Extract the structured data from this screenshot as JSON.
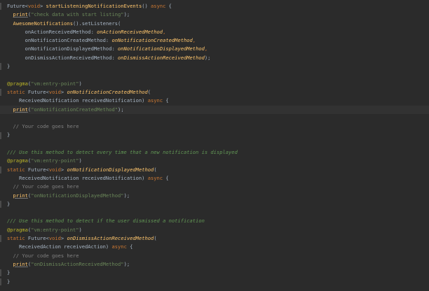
{
  "lines": [
    [
      {
        "t": "Future<",
        "c": "plain"
      },
      {
        "t": "void",
        "c": "kw"
      },
      {
        "t": "> ",
        "c": "plain"
      },
      {
        "t": "startListeningNotificationEvents",
        "c": "fn"
      },
      {
        "t": "() ",
        "c": "plain"
      },
      {
        "t": "async",
        "c": "kw"
      },
      {
        "t": " {",
        "c": "plain"
      }
    ],
    [
      {
        "t": "  ",
        "c": "plain"
      },
      {
        "t": "print",
        "c": "call-u"
      },
      {
        "t": "(",
        "c": "plain"
      },
      {
        "t": "\"check data with start listing\"",
        "c": "str"
      },
      {
        "t": ");",
        "c": "plain"
      }
    ],
    [
      {
        "t": "  ",
        "c": "plain"
      },
      {
        "t": "AwesomeNotifications",
        "c": "call"
      },
      {
        "t": "().setListeners(",
        "c": "plain"
      }
    ],
    [
      {
        "t": "      onActionReceivedMethod: ",
        "c": "plain"
      },
      {
        "t": "onActionReceivedMethod",
        "c": "ital"
      },
      {
        "t": ",",
        "c": "kw"
      }
    ],
    [
      {
        "t": "      onNotificationCreatedMethod: ",
        "c": "plain"
      },
      {
        "t": "onNotificationCreatedMethod",
        "c": "ital"
      },
      {
        "t": ",",
        "c": "kw"
      }
    ],
    [
      {
        "t": "      onNotificationDisplayedMethod: ",
        "c": "plain"
      },
      {
        "t": "onNotificationDisplayedMethod",
        "c": "ital"
      },
      {
        "t": ",",
        "c": "kw"
      }
    ],
    [
      {
        "t": "      onDismissActionReceivedMethod: ",
        "c": "plain"
      },
      {
        "t": "onDismissActionReceivedMethod",
        "c": "ital"
      },
      {
        "t": ");",
        "c": "plain"
      }
    ],
    [
      {
        "t": "}",
        "c": "plain"
      }
    ],
    [],
    [
      {
        "t": "@pragma",
        "c": "ann"
      },
      {
        "t": "(",
        "c": "plain"
      },
      {
        "t": "\"vm:entry-point\"",
        "c": "str"
      },
      {
        "t": ")",
        "c": "plain"
      }
    ],
    [
      {
        "t": "static ",
        "c": "kw"
      },
      {
        "t": "Future<",
        "c": "plain"
      },
      {
        "t": "void",
        "c": "kw"
      },
      {
        "t": "> ",
        "c": "plain"
      },
      {
        "t": "onNotificationCreatedMethod",
        "c": "ital"
      },
      {
        "t": "(",
        "c": "plain"
      }
    ],
    [
      {
        "t": "    ReceivedNotification receivedNotification) ",
        "c": "plain"
      },
      {
        "t": "async",
        "c": "kw"
      },
      {
        "t": " {",
        "c": "plain"
      }
    ],
    [
      {
        "t": "  ",
        "c": "plain"
      },
      {
        "t": "print",
        "c": "call-u"
      },
      {
        "t": "(",
        "c": "plain"
      },
      {
        "t": "\"onNotificationCreatedMethod\"",
        "c": "str"
      },
      {
        "t": ");",
        "c": "plain"
      }
    ],
    [],
    [
      {
        "t": "  // Your code goes here",
        "c": "cmt"
      }
    ],
    [
      {
        "t": "}",
        "c": "plain"
      }
    ],
    [],
    [
      {
        "t": "/// Use this method to detect every time that a new notification is displayed",
        "c": "doc"
      }
    ],
    [
      {
        "t": "@pragma",
        "c": "ann"
      },
      {
        "t": "(",
        "c": "plain"
      },
      {
        "t": "\"vm:entry-point\"",
        "c": "str"
      },
      {
        "t": ")",
        "c": "plain"
      }
    ],
    [
      {
        "t": "static ",
        "c": "kw"
      },
      {
        "t": "Future<",
        "c": "plain"
      },
      {
        "t": "void",
        "c": "kw"
      },
      {
        "t": "> ",
        "c": "plain"
      },
      {
        "t": "onNotificationDisplayedMethod",
        "c": "ital"
      },
      {
        "t": "(",
        "c": "plain"
      }
    ],
    [
      {
        "t": "    ReceivedNotification receivedNotification) ",
        "c": "plain"
      },
      {
        "t": "async",
        "c": "kw"
      },
      {
        "t": " {",
        "c": "plain"
      }
    ],
    [
      {
        "t": "  // Your code goes here",
        "c": "cmt"
      }
    ],
    [
      {
        "t": "  ",
        "c": "plain"
      },
      {
        "t": "print",
        "c": "call-u"
      },
      {
        "t": "(",
        "c": "plain"
      },
      {
        "t": "\"onNotificationDisplayedMethod\"",
        "c": "str"
      },
      {
        "t": ");",
        "c": "plain"
      }
    ],
    [
      {
        "t": "}",
        "c": "plain"
      }
    ],
    [],
    [
      {
        "t": "/// Use this method to detect if the user dismissed a notification",
        "c": "doc"
      }
    ],
    [
      {
        "t": "@pragma",
        "c": "ann"
      },
      {
        "t": "(",
        "c": "plain"
      },
      {
        "t": "\"vm:entry-point\"",
        "c": "str"
      },
      {
        "t": ")",
        "c": "plain"
      }
    ],
    [
      {
        "t": "static ",
        "c": "kw"
      },
      {
        "t": "Future<",
        "c": "plain"
      },
      {
        "t": "void",
        "c": "kw"
      },
      {
        "t": "> ",
        "c": "plain"
      },
      {
        "t": "onDismissActionReceivedMethod",
        "c": "ital"
      },
      {
        "t": "(",
        "c": "plain"
      }
    ],
    [
      {
        "t": "    ReceivedAction receivedAction) ",
        "c": "plain"
      },
      {
        "t": "async",
        "c": "kw"
      },
      {
        "t": " {",
        "c": "plain"
      }
    ],
    [
      {
        "t": "  // Your code goes here",
        "c": "cmt"
      }
    ],
    [
      {
        "t": "  ",
        "c": "plain"
      },
      {
        "t": "print",
        "c": "call-u"
      },
      {
        "t": "(",
        "c": "plain"
      },
      {
        "t": "\"onDismissActionReceivedMethod\"",
        "c": "str"
      },
      {
        "t": ");",
        "c": "plain"
      }
    ],
    [
      {
        "t": "}",
        "c": "plain"
      }
    ],
    [
      {
        "t": "}",
        "c": "plain"
      }
    ]
  ]
}
